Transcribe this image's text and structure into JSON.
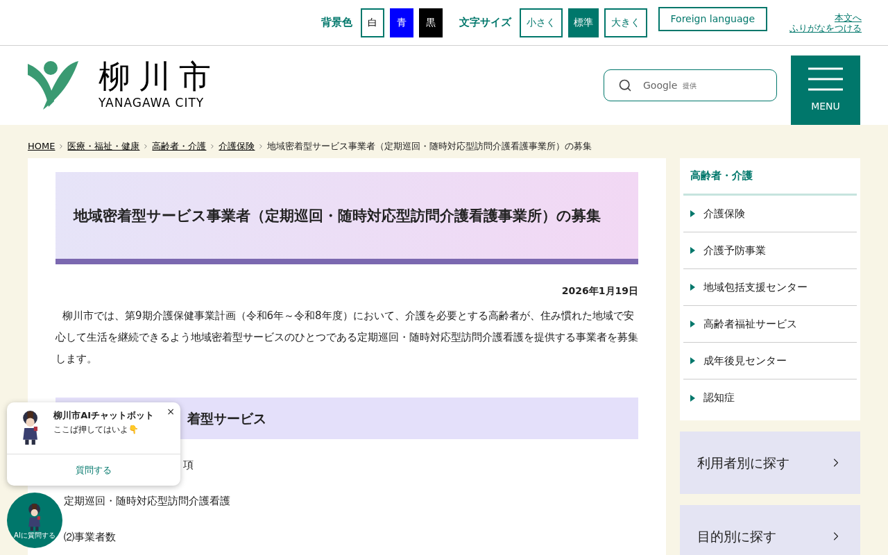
{
  "utility_bar": {
    "bg_label": "背景色",
    "bg_options": [
      {
        "label": "白",
        "kind": "white"
      },
      {
        "label": "青",
        "kind": "blue"
      },
      {
        "label": "黒",
        "kind": "black"
      }
    ],
    "size_label": "文字サイズ",
    "size_options": [
      {
        "label": "小さく",
        "selected": false
      },
      {
        "label": "標準",
        "selected": true
      },
      {
        "label": "大きく",
        "selected": false
      }
    ],
    "foreign_button": "Foreign language",
    "furigana_link": [
      "本文へ",
      "ふりがなをつける"
    ]
  },
  "header": {
    "logo_kanji": "柳川市",
    "logo_roman": "YANAGAWA CITY",
    "search": {
      "placeholder": "Google",
      "provider": "提供"
    },
    "menu_button": "MENU"
  },
  "breadcrumb": [
    {
      "label": "HOME",
      "link": true
    },
    {
      "label": "医療・福祉・健康",
      "link": true
    },
    {
      "label": "高齢者・介護",
      "link": true
    },
    {
      "label": "介護保険",
      "link": true
    },
    {
      "label": "地域密着型サービス事業者（定期巡回・随時対応型訪問介護看護事業所）の募集",
      "link": false
    }
  ],
  "article": {
    "title": "地域密着型サービス事業者（定期巡回・随時対応型訪問介護看護事業所）の募集",
    "date": "2026年1月19日",
    "intro": "柳川市では、第9期介護保健事業計画（令和6年～令和8年度）において、介護を必要とする高齢者が、住み慣れた地域で安心して生活を継続できるよう地域密着型サービスのひとつである定期巡回・随時対応型訪問介護看護を提供する事業者を募集します。",
    "section_heading": "着型サービス",
    "items": [
      "項",
      "定期巡回・随時対応型訪問介護看護",
      "⑵事業者数"
    ]
  },
  "sidebar": {
    "title": "高齢者・介護",
    "items": [
      "介護保険",
      "介護予防事業",
      "地域包括支援センター",
      "高齢者福祉サービス",
      "成年後見センター",
      "認知症"
    ],
    "finders": [
      "利用者別に探す",
      "目的別に探す"
    ]
  },
  "chatbot": {
    "title": "柳川市AIチャットボット",
    "message": "ここば押してはいよ👇",
    "close": "×",
    "action": "質問する",
    "launcher": "AIに質問する"
  }
}
